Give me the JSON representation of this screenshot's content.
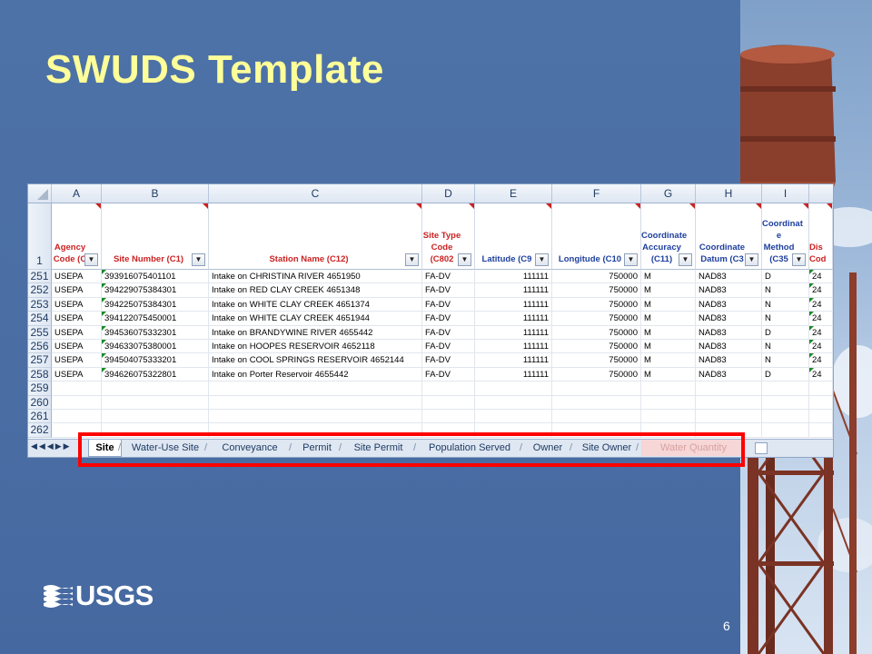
{
  "slide": {
    "title": "SWUDS Template",
    "page_number": "6",
    "logo_text": "USGS"
  },
  "spreadsheet": {
    "columns": [
      "A",
      "B",
      "C",
      "D",
      "E",
      "F",
      "G",
      "H",
      "I"
    ],
    "header_row_number": "1",
    "headers": [
      {
        "col": "A",
        "lines": [
          "Agency",
          "Code (C"
        ],
        "color": "red"
      },
      {
        "col": "B",
        "lines": [
          "Site Number (C1)"
        ],
        "color": "red"
      },
      {
        "col": "C",
        "lines": [
          "Station Name (C12)"
        ],
        "color": "red"
      },
      {
        "col": "D",
        "lines": [
          "Site Type",
          "Code",
          "(C802"
        ],
        "color": "red"
      },
      {
        "col": "E",
        "lines": [
          "Latitude (C9"
        ],
        "color": "blue"
      },
      {
        "col": "F",
        "lines": [
          "Longitude (C10"
        ],
        "color": "blue"
      },
      {
        "col": "G",
        "lines": [
          "Coordinate",
          "Accuracy",
          "(C11)"
        ],
        "color": "blue"
      },
      {
        "col": "H",
        "lines": [
          "Coordinate",
          "Datum (C3"
        ],
        "color": "blue"
      },
      {
        "col": "I",
        "lines": [
          "Coordinat",
          "e Method",
          "(C35"
        ],
        "color": "blue"
      },
      {
        "col": "J",
        "lines": [
          "Dis",
          "Cod"
        ],
        "color": "red"
      }
    ],
    "rows": [
      {
        "num": "251",
        "cells": [
          "USEPA",
          "393916075401101",
          "Intake on CHRISTINA RIVER 4651950",
          "FA-DV",
          "111111",
          "750000",
          "M",
          "NAD83",
          "D",
          "24"
        ]
      },
      {
        "num": "252",
        "cells": [
          "USEPA",
          "394229075384301",
          "Intake on RED CLAY CREEK 4651348",
          "FA-DV",
          "111111",
          "750000",
          "M",
          "NAD83",
          "N",
          "24"
        ]
      },
      {
        "num": "253",
        "cells": [
          "USEPA",
          "394225075384301",
          "Intake on WHITE CLAY CREEK 4651374",
          "FA-DV",
          "111111",
          "750000",
          "M",
          "NAD83",
          "N",
          "24"
        ]
      },
      {
        "num": "254",
        "cells": [
          "USEPA",
          "394122075450001",
          "Intake on WHITE CLAY CREEK 4651944",
          "FA-DV",
          "111111",
          "750000",
          "M",
          "NAD83",
          "N",
          "24"
        ]
      },
      {
        "num": "255",
        "cells": [
          "USEPA",
          "394536075332301",
          "Intake on BRANDYWINE RIVER 4655442",
          "FA-DV",
          "111111",
          "750000",
          "M",
          "NAD83",
          "D",
          "24"
        ]
      },
      {
        "num": "256",
        "cells": [
          "USEPA",
          "394633075380001",
          "Intake on HOOPES RESERVOIR 4652118",
          "FA-DV",
          "111111",
          "750000",
          "M",
          "NAD83",
          "N",
          "24"
        ]
      },
      {
        "num": "257",
        "cells": [
          "USEPA",
          "394504075333201",
          "Intake on COOL SPRINGS RESERVOIR 4652144",
          "FA-DV",
          "111111",
          "750000",
          "M",
          "NAD83",
          "N",
          "24"
        ]
      },
      {
        "num": "258",
        "cells": [
          "USEPA",
          "394626075322801",
          "Intake on Porter Reservoir 4655442",
          "FA-DV",
          "111111",
          "750000",
          "M",
          "NAD83",
          "D",
          "24"
        ]
      },
      {
        "num": "259",
        "cells": [
          "",
          "",
          "",
          "",
          "",
          "",
          "",
          "",
          "",
          ""
        ]
      },
      {
        "num": "260",
        "cells": [
          "",
          "",
          "",
          "",
          "",
          "",
          "",
          "",
          "",
          ""
        ]
      },
      {
        "num": "261",
        "cells": [
          "",
          "",
          "",
          "",
          "",
          "",
          "",
          "",
          "",
          ""
        ]
      },
      {
        "num": "262",
        "cells": [
          "",
          "",
          "",
          "",
          "",
          "",
          "",
          "",
          "",
          ""
        ]
      }
    ],
    "sheet_tabs": [
      "Site",
      "Water-Use Site",
      "Conveyance",
      "Permit",
      "Site Permit",
      "Population Served",
      "Owner",
      "Site Owner",
      "Water Quantity"
    ],
    "active_tab": "Site",
    "highlight_color": "#ff0000"
  },
  "colors": {
    "background": "#4a6fa5",
    "title": "#ffff99",
    "required_header": "#cc2222",
    "optional_header": "#1d3f9e"
  }
}
